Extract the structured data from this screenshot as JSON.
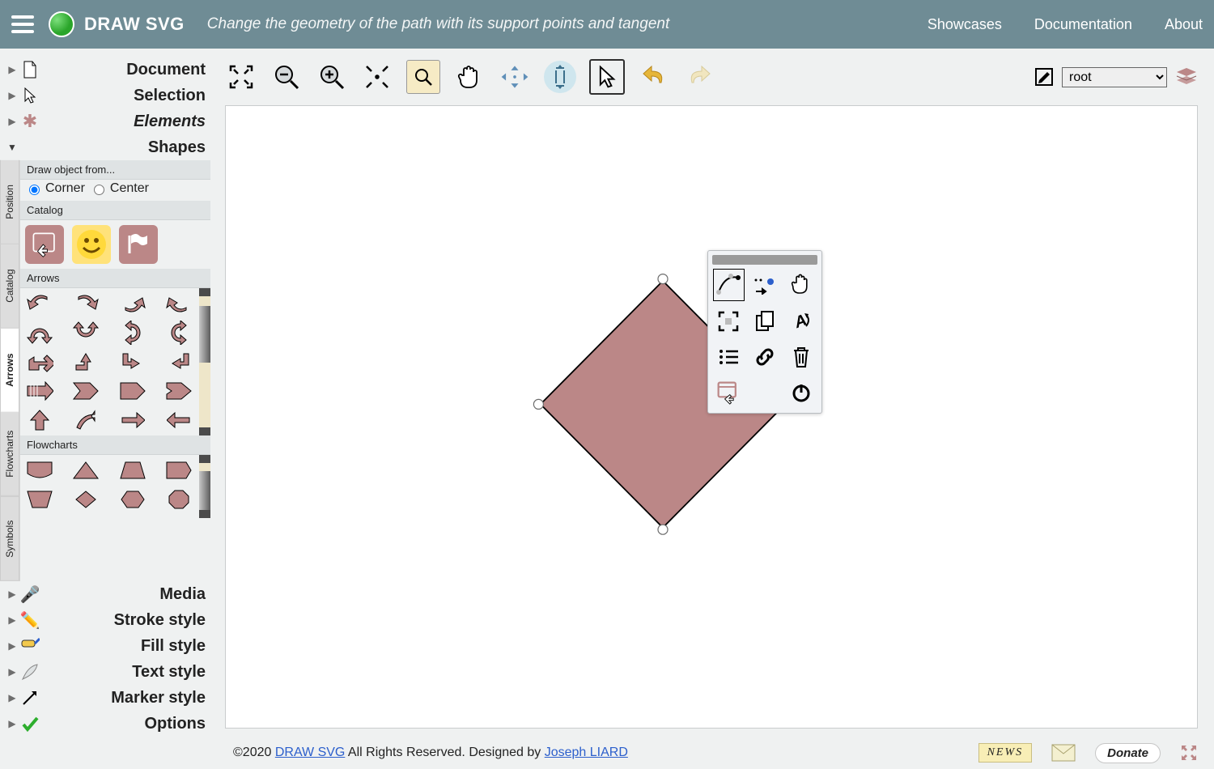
{
  "app": {
    "name": "DRAW SVG",
    "hint": "Change the geometry of the path with its support points and tangent"
  },
  "nav": {
    "showcases": "Showcases",
    "documentation": "Documentation",
    "about": "About"
  },
  "sections": {
    "document": "Document",
    "selection": "Selection",
    "elements": "Elements",
    "shapes": "Shapes",
    "media": "Media",
    "stroke": "Stroke style",
    "fill": "Fill style",
    "text": "Text style",
    "marker": "Marker style",
    "options": "Options"
  },
  "shapes": {
    "draw_from": "Draw object from...",
    "corner": "Corner",
    "center": "Center",
    "catalog": "Catalog",
    "arrows": "Arrows",
    "flowcharts": "Flowcharts",
    "tabs": {
      "position": "Position",
      "catalog": "Catalog",
      "arrows": "Arrows",
      "flowcharts": "Flowcharts",
      "symbols": "Symbols"
    }
  },
  "toolbar": {
    "root_select": "root"
  },
  "footer": {
    "copyright": "©2020 ",
    "brand": "DRAW SVG",
    "mid": " All Rights Reserved. Designed by ",
    "author": "Joseph LIARD",
    "news": "NEWS",
    "donate": "Donate"
  }
}
